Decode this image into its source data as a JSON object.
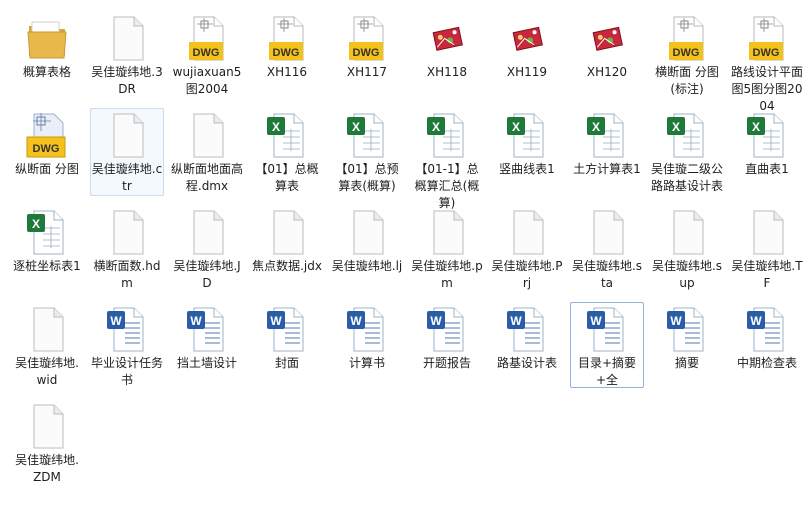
{
  "view": "large-icons",
  "colors": {
    "selection_border": "#c8ddf1",
    "focus_border": "#8fb5d9",
    "dwg_yellow": "#f4c21a",
    "excel_green": "#1f7a3a",
    "word_blue": "#2a5ca8",
    "folder_yellow": "#e8b84a"
  },
  "files": [
    {
      "label": "概算表格",
      "icon": "folder-icon",
      "state": ""
    },
    {
      "label": "吴佳璇纬地.3DR",
      "icon": "blank-file-icon",
      "state": ""
    },
    {
      "label": "wujiaxuan5图2004",
      "icon": "dwg-file-icon",
      "state": ""
    },
    {
      "label": "XH116",
      "icon": "dwg-file-icon",
      "state": ""
    },
    {
      "label": "XH117",
      "icon": "dwg-file-icon",
      "state": ""
    },
    {
      "label": "XH118",
      "icon": "image-thumbnail-icon",
      "state": ""
    },
    {
      "label": "XH119",
      "icon": "image-thumbnail-icon",
      "state": ""
    },
    {
      "label": "XH120",
      "icon": "image-thumbnail-icon",
      "state": ""
    },
    {
      "label": "横断面 分图(标注)",
      "icon": "dwg-file-icon",
      "state": ""
    },
    {
      "label": "路线设计平面图5图分图2004",
      "icon": "dwg-file-icon",
      "state": ""
    },
    {
      "label": "纵断面 分图",
      "icon": "dwg-cad-file-icon",
      "state": ""
    },
    {
      "label": "吴佳璇纬地.ctr",
      "icon": "blank-file-icon",
      "state": "selected"
    },
    {
      "label": "纵断面地面高程.dmx",
      "icon": "blank-file-icon",
      "state": ""
    },
    {
      "label": "【01】总概算表",
      "icon": "excel-file-icon",
      "state": ""
    },
    {
      "label": "【01】总预算表(概算)",
      "icon": "excel-file-icon",
      "state": ""
    },
    {
      "label": "【01-1】总概算汇总(概算)",
      "icon": "excel-file-icon",
      "state": ""
    },
    {
      "label": "竖曲线表1",
      "icon": "excel-file-icon",
      "state": ""
    },
    {
      "label": "土方计算表1",
      "icon": "excel-file-icon",
      "state": ""
    },
    {
      "label": "吴佳璇二级公路路基设计表",
      "icon": "excel-file-icon",
      "state": ""
    },
    {
      "label": "直曲表1",
      "icon": "excel-file-icon",
      "state": ""
    },
    {
      "label": "逐桩坐标表1",
      "icon": "excel-file-icon",
      "state": ""
    },
    {
      "label": "横断面数.hdm",
      "icon": "blank-file-icon",
      "state": ""
    },
    {
      "label": "吴佳璇纬地.JD",
      "icon": "blank-file-icon",
      "state": ""
    },
    {
      "label": "焦点数据.jdx",
      "icon": "blank-file-icon",
      "state": ""
    },
    {
      "label": "吴佳璇纬地.lj",
      "icon": "blank-file-icon",
      "state": ""
    },
    {
      "label": "吴佳璇纬地.pm",
      "icon": "blank-file-icon",
      "state": ""
    },
    {
      "label": "吴佳璇纬地.Prj",
      "icon": "blank-file-icon",
      "state": ""
    },
    {
      "label": "吴佳璇纬地.sta",
      "icon": "blank-file-icon",
      "state": ""
    },
    {
      "label": "吴佳璇纬地.sup",
      "icon": "blank-file-icon",
      "state": ""
    },
    {
      "label": "吴佳璇纬地.TF",
      "icon": "blank-file-icon",
      "state": ""
    },
    {
      "label": "吴佳璇纬地.wid",
      "icon": "blank-file-icon",
      "state": ""
    },
    {
      "label": "毕业设计任务书",
      "icon": "word-file-icon",
      "state": ""
    },
    {
      "label": "挡土墙设计",
      "icon": "word-file-icon",
      "state": ""
    },
    {
      "label": "封面",
      "icon": "word-file-icon",
      "state": ""
    },
    {
      "label": "计算书",
      "icon": "word-file-icon",
      "state": ""
    },
    {
      "label": "开题报告",
      "icon": "word-file-icon",
      "state": ""
    },
    {
      "label": "路基设计表",
      "icon": "word-file-icon",
      "state": ""
    },
    {
      "label": "目录+摘要+全",
      "icon": "word-file-icon",
      "state": "focused"
    },
    {
      "label": "摘要",
      "icon": "word-file-icon",
      "state": ""
    },
    {
      "label": "中期检查表",
      "icon": "word-file-icon",
      "state": ""
    },
    {
      "label": "吴佳璇纬地.ZDM",
      "icon": "blank-file-icon",
      "state": ""
    }
  ]
}
